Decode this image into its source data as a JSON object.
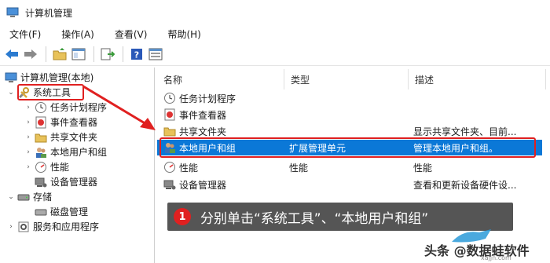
{
  "window": {
    "title": "计算机管理"
  },
  "menubar": [
    "文件(F)",
    "操作(A)",
    "查看(V)",
    "帮助(H)"
  ],
  "toolbar": [
    "back-icon",
    "forward-icon",
    "up-folder-icon",
    "show-hide-tree-icon",
    "export-icon",
    "help-icon",
    "properties-icon"
  ],
  "tree": {
    "root": "计算机管理(本地)",
    "system_tools": "系统工具",
    "children": [
      "任务计划程序",
      "事件查看器",
      "共享文件夹",
      "本地用户和组",
      "性能",
      "设备管理器"
    ],
    "storage": "存储",
    "storage_children": [
      "磁盘管理"
    ],
    "services": "服务和应用程序"
  },
  "list": {
    "columns": [
      "名称",
      "类型",
      "描述"
    ],
    "rows": [
      {
        "name": "任务计划程序",
        "type": "",
        "desc": ""
      },
      {
        "name": "事件查看器",
        "type": "",
        "desc": ""
      },
      {
        "name": "共享文件夹",
        "type": "",
        "desc": "显示共享文件夹、目前..."
      },
      {
        "name": "本地用户和组",
        "type": "扩展管理单元",
        "desc": "管理本地用户和组。"
      },
      {
        "name": "性能",
        "type": "性能",
        "desc": "性能"
      },
      {
        "name": "设备管理器",
        "type": "",
        "desc": "查看和更新设备硬件设..."
      }
    ],
    "selected_index": 3
  },
  "callout": {
    "number": "1",
    "text": "分别单击“系统工具”、“本地用户和组”"
  },
  "watermark": {
    "text": "头条 @数据蛙软件",
    "small": "xajjn.com"
  },
  "colors": {
    "highlight": "#e02020",
    "selected": "#0b78d7"
  }
}
